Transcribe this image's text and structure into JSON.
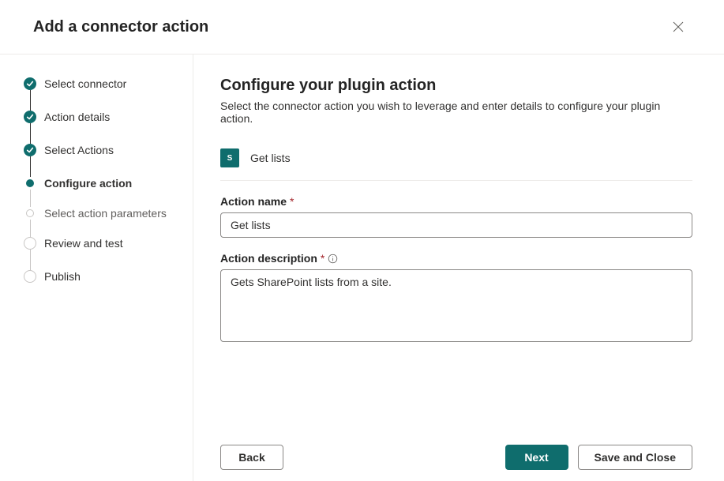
{
  "header": {
    "title": "Add a connector action"
  },
  "steps": [
    {
      "label": "Select connector",
      "state": "completed"
    },
    {
      "label": "Action details",
      "state": "completed"
    },
    {
      "label": "Select Actions",
      "state": "completed"
    },
    {
      "label": "Configure action",
      "state": "current"
    },
    {
      "label": "Select action parameters",
      "state": "upcoming"
    },
    {
      "label": "Review and test",
      "state": "empty"
    },
    {
      "label": "Publish",
      "state": "empty"
    }
  ],
  "main": {
    "heading": "Configure your plugin action",
    "subtitle": "Select the connector action you wish to leverage and enter details to configure your plugin action.",
    "connector": {
      "icon_label": "S",
      "name": "Get lists"
    },
    "fields": {
      "action_name": {
        "label": "Action name",
        "value": "Get lists"
      },
      "action_description": {
        "label": "Action description",
        "value": "Gets SharePoint lists from a site."
      }
    }
  },
  "footer": {
    "back": "Back",
    "next": "Next",
    "save_close": "Save and Close"
  }
}
